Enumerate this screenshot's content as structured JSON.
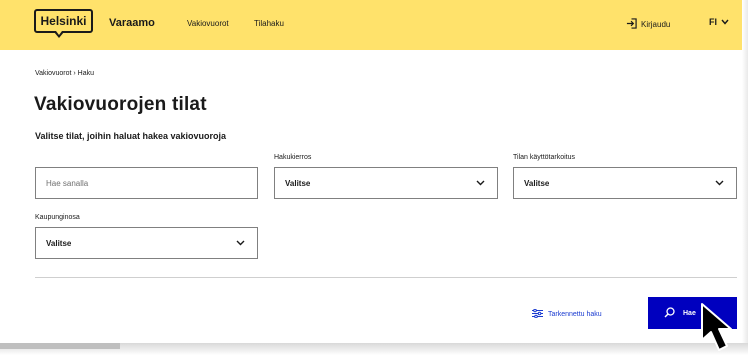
{
  "header": {
    "logo_text": "Helsinki",
    "app_name": "Varaamo",
    "nav": [
      "Vakiovuorot",
      "Tilahaku"
    ],
    "login_label": "Kirjaudu",
    "language": "FI",
    "bg_color": "#ffe26b"
  },
  "breadcrumb": "Vakiovuorot › Haku",
  "page_title": "Vakiovuorojen tilat",
  "subtitle": "Valitse tilat, joihin haluat hakea vakiovuoroja",
  "search": {
    "placeholder": "Hae sanalla",
    "hakukierros_label": "Hakukierros",
    "hakukierros_value": "Valitse",
    "kayttotarkoitus_label": "Tilan käyttötarkoitus",
    "kayttotarkoitus_value": "Valitse",
    "kaupunginosa_label": "Kaupunginosa",
    "kaupunginosa_value": "Valitse"
  },
  "actions": {
    "advanced_label": "Tarkennettu haku",
    "search_label": "Hae",
    "accent_color": "#0000bf"
  },
  "icons": [
    "login-icon",
    "chevron-down-icon",
    "sliders-icon",
    "search-icon",
    "mouse-pointer-icon"
  ]
}
